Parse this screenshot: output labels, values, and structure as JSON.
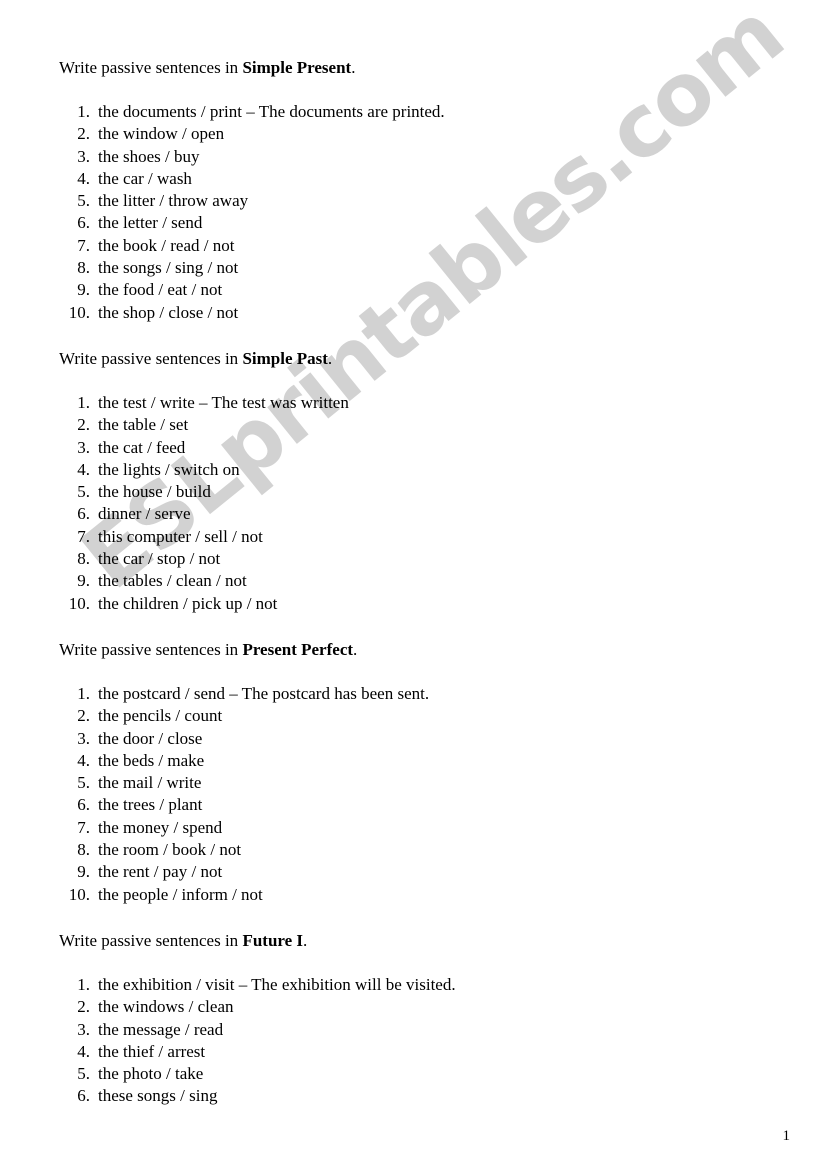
{
  "watermark": {
    "text": "ESLprintables.com",
    "color": "#d2d2d2"
  },
  "page_number": "1",
  "sections": [
    {
      "lead": "Write passive sentences in ",
      "tense": "Simple Present",
      "trailing": ".",
      "items": [
        "the documents / print – The documents are printed.",
        "the window / open",
        "the shoes / buy",
        "the car / wash",
        "the litter / throw away",
        "the letter / send",
        "the book / read / not",
        "the songs / sing / not",
        "the food / eat / not",
        "the shop / close / not"
      ]
    },
    {
      "lead": "Write passive sentences in ",
      "tense": "Simple Past",
      "trailing": ".",
      "items": [
        "the test / write – The test was written",
        "the table / set",
        "the cat / feed",
        "the lights / switch on",
        "the house / build",
        "dinner / serve",
        "this computer / sell / not",
        "the car / stop / not",
        "the tables / clean / not",
        "the children / pick up / not"
      ]
    },
    {
      "lead": "Write passive sentences in ",
      "tense": "Present Perfect",
      "trailing": ".",
      "items": [
        "the postcard / send – The postcard has been sent.",
        "the pencils / count",
        "the door / close",
        "the beds / make",
        "the mail / write",
        "the trees / plant",
        "the money / spend",
        "the room / book / not",
        "the rent / pay / not",
        "the people / inform / not"
      ]
    },
    {
      "lead": "Write passive sentences in ",
      "tense": "Future I",
      "trailing": ".",
      "items": [
        "the exhibition / visit – The exhibition will be visited.",
        "the windows / clean",
        "the message / read",
        "the thief / arrest",
        "the photo / take",
        "these songs / sing"
      ]
    }
  ]
}
